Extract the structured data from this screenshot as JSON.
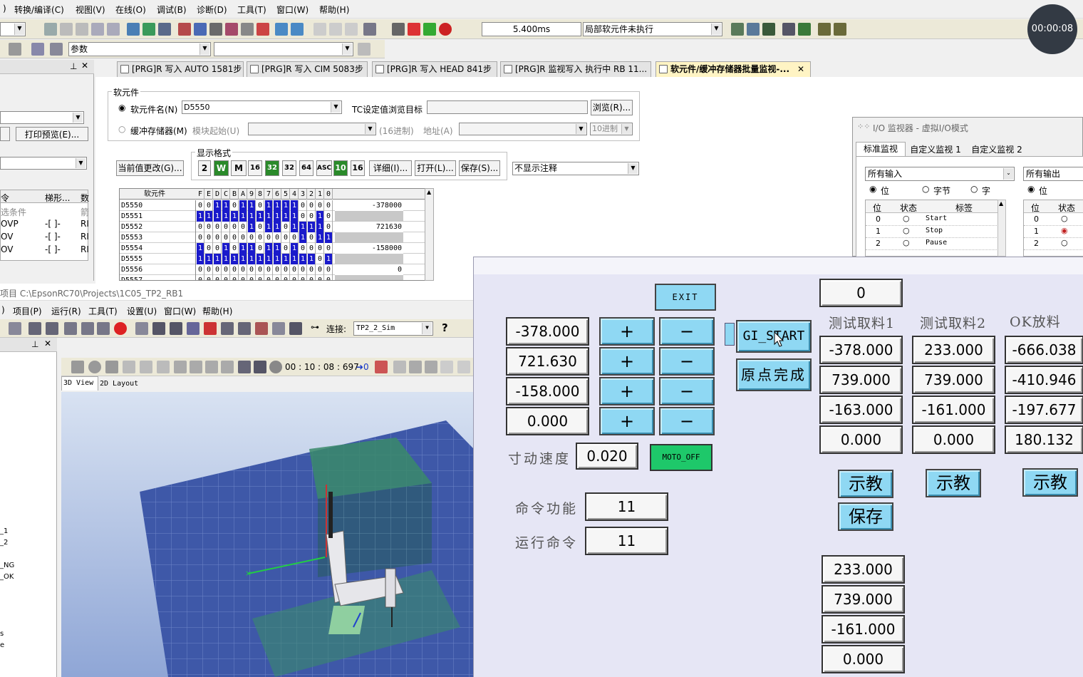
{
  "gx": {
    "menu": [
      "转换/编译(C)",
      "视图(V)",
      "在线(O)",
      "调试(B)",
      "诊断(D)",
      "工具(T)",
      "窗口(W)",
      "帮助(H)"
    ],
    "scan_time": "5.400ms",
    "status_combo": "局部软元件未执行",
    "param_combo": "参数",
    "timer": "00:00:08",
    "tabs": [
      "[PRG]R 写入 AUTO 1581步",
      "[PRG]R 写入 CIM 5083步",
      "[PRG]R 写入 HEAD 841步",
      "[PRG]R 监视写入 执行中 RB 11...",
      "软元件/缓冲存储器批量监视-..."
    ],
    "left_panel": {
      "print_preview": "打印预览(E)...",
      "header_cols": [
        "令",
        "梯形...",
        "数"
      ],
      "rows": [
        [
          "选条件",
          "",
          "箭"
        ],
        [
          "OVP",
          "-[ ]-",
          "RI"
        ],
        [
          "OV",
          "-[ ]-",
          "RI"
        ],
        [
          "OV",
          "-[ ]-",
          "RI"
        ]
      ]
    },
    "device": {
      "group_title": "软元件",
      "radio_device": "软元件名(N)",
      "device_value": "D5550",
      "tc_label": "TC设定值浏览目标",
      "browse": "浏览(R)...",
      "radio_buffer": "缓冲存储器(M)",
      "module_start": "模块起始(U)",
      "hex16": "(16进制)",
      "address": "地址(A)",
      "radix": "10进制",
      "format_title": "显示格式",
      "current_change": "当前值更改(G)...",
      "fmt_buttons": [
        "2",
        "W",
        "M",
        "16",
        "32",
        "32",
        "64",
        "ASC",
        "10",
        "16"
      ],
      "detail": "详细(I)...",
      "open": "打开(L)...",
      "save": "保存(S)...",
      "comment_combo": "不显示注释",
      "table_header_name": "软元件",
      "bit_headers": [
        "F",
        "E",
        "D",
        "C",
        "B",
        "A",
        "9",
        "8",
        "7",
        "6",
        "5",
        "4",
        "3",
        "2",
        "1",
        "0"
      ],
      "rows": [
        {
          "name": "D5550",
          "bits": "0011011011110000",
          "value": "-378000"
        },
        {
          "name": "D5551",
          "bits": "1111111111110010",
          "value": ""
        },
        {
          "name": "D5552",
          "bits": "0000001011011110",
          "value": "721630"
        },
        {
          "name": "D5553",
          "bits": "0000000000001011",
          "value": ""
        },
        {
          "name": "D5554",
          "bits": "1001011011010000",
          "value": "-158000"
        },
        {
          "name": "D5555",
          "bits": "1111111111111101",
          "value": ""
        },
        {
          "name": "D5556",
          "bits": "0000000000000000",
          "value": "0"
        },
        {
          "name": "D5557",
          "bits": "0000000000000000",
          "value": ""
        }
      ]
    }
  },
  "io": {
    "title": "I/O 监视器 - 虚拟I/O模式",
    "tabs": [
      "标准监视",
      "自定义监视 1",
      "自定义监视 2"
    ],
    "input_combo": "所有输入",
    "output_combo": "所有输出",
    "radios": [
      "位",
      "字节",
      "字"
    ],
    "radio_out": "位",
    "cols": [
      "位",
      "状态",
      "标签"
    ],
    "out_cols": [
      "位",
      "状态"
    ],
    "rows": [
      {
        "bit": "0",
        "label": "Start"
      },
      {
        "bit": "1",
        "label": "Stop"
      },
      {
        "bit": "2",
        "label": "Pause"
      }
    ],
    "out_rows": [
      "0",
      "1",
      "2"
    ],
    "out_active_color": "#c02020"
  },
  "epson": {
    "path": "项目 C:\\EpsonRC70\\Projects\\1C05_TP2_RB1",
    "menu": [
      ")",
      "项目(P)",
      "运行(R)",
      "工具(T)",
      "设置(U)",
      "窗口(W)",
      "帮助(H)"
    ],
    "connect_label": "连接:",
    "connect_value": "TP2_2_Sim",
    "sim_time": "00 : 10 : 08 : 697",
    "sim_count": "0",
    "view_tabs": [
      "3D View",
      "2D Layout"
    ],
    "left_items": [
      "_1",
      "_2",
      "_NG",
      "_OK",
      "s",
      "e"
    ]
  },
  "hmi": {
    "exit": "EXIT",
    "top_value": "0",
    "jog_values": [
      "-378.000",
      "721.630",
      "-158.000",
      "0.000"
    ],
    "plus": "+",
    "minus": "−",
    "gi_start": "GI_START",
    "origin_done": "原点完成",
    "jog_speed_label": "寸动速度",
    "jog_speed": "0.020",
    "moto_off": "MOTO_OFF",
    "cmd_func_label": "命令功能",
    "cmd_func": "11",
    "run_cmd_label": "运行命令",
    "run_cmd": "11",
    "col_titles": [
      "测试取料1",
      "测试取料2",
      "OK放料"
    ],
    "col1": [
      "-378.000",
      "739.000",
      "-163.000",
      "0.000"
    ],
    "col2": [
      "233.000",
      "739.000",
      "-161.000",
      "0.000"
    ],
    "col3": [
      "-666.038",
      "-410.946",
      "-197.677",
      "180.132"
    ],
    "teach": "示教",
    "save": "保存",
    "bottom": [
      "233.000",
      "739.000",
      "-161.000",
      "0.000"
    ],
    "accent": "#8fd8f3",
    "moto_color": "#1ec86a"
  }
}
